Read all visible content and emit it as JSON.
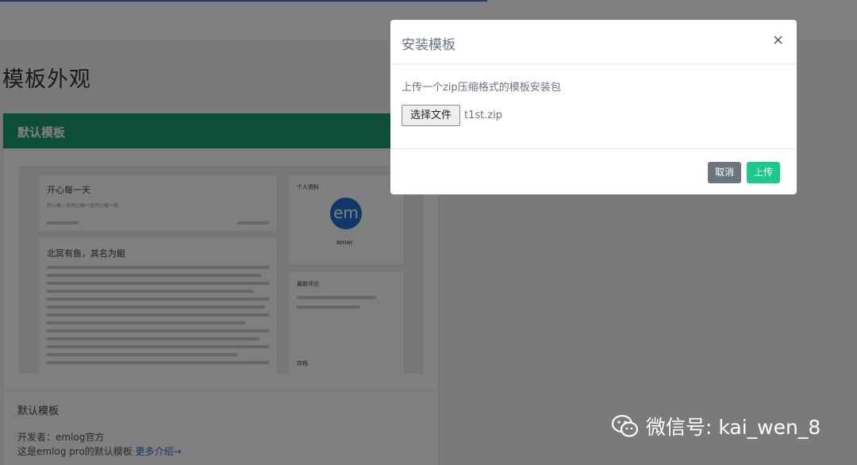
{
  "page": {
    "title": "模板外观"
  },
  "template_card": {
    "header": "默认模板",
    "name": "默认模板",
    "developer": "开发者：emlog官方",
    "description": "这是emlog pro的默认模板",
    "more_link": "更多介绍→",
    "preview": {
      "post1_title": "开心每一天",
      "post1_sub": "开心每一天开心每一天开心每一天",
      "post2_title": "北冥有鱼，其名为鲲",
      "side_profile": "个人资料",
      "avatar_text": "em",
      "side_name": "emer",
      "side_comments": "最新评论",
      "side_tags": "存档"
    }
  },
  "modal": {
    "title": "安装模板",
    "close": "×",
    "hint": "上传一个zip压缩格式的模板安装包",
    "file_button": "选择文件",
    "file_name": "t1st.zip",
    "cancel": "取消",
    "upload": "上传"
  },
  "watermark": {
    "text": "微信号: kai_wen_8",
    "icon": "wechat-icon"
  },
  "colors": {
    "header_green": "#1e9c6c",
    "upload_green": "#1cc88a",
    "cancel_gray": "#6c757d",
    "link_blue": "#2f6fd6"
  }
}
